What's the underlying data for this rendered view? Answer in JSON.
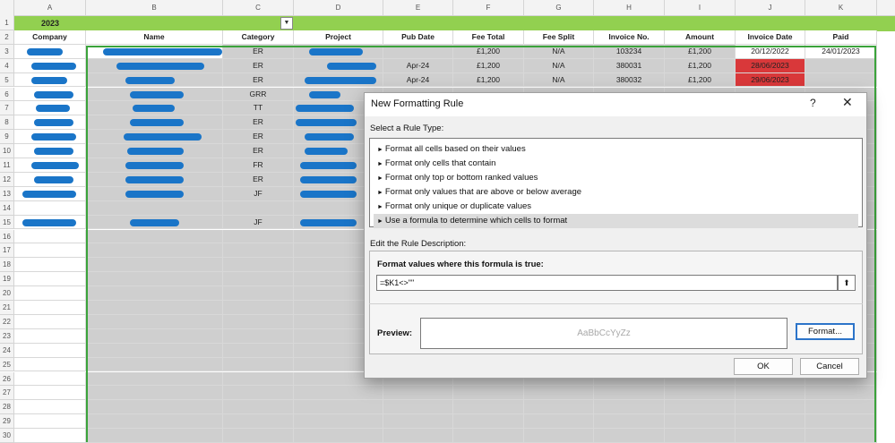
{
  "sheet": {
    "columns": [
      "A",
      "B",
      "C",
      "D",
      "E",
      "F",
      "G",
      "H",
      "I",
      "J",
      "K"
    ],
    "row_numbers": [
      "1",
      "2",
      "3",
      "4",
      "5",
      "6",
      "7",
      "8",
      "9",
      "10",
      "11",
      "12",
      "13",
      "14",
      "15",
      "16",
      "17",
      "18",
      "19",
      "20",
      "21",
      "22",
      "23",
      "24",
      "25",
      "26",
      "27",
      "28",
      "29",
      "30"
    ],
    "year_label": "2023",
    "headers": [
      "Company",
      "Name",
      "Category",
      "Project",
      "Pub Date",
      "Fee Total",
      "Fee Split",
      "Invoice No.",
      "Amount",
      "Invoice Date",
      "Paid"
    ],
    "rows": [
      [
        "",
        "",
        "ER",
        "",
        "",
        "£1,200",
        "N/A",
        "103234",
        "£1,200",
        "20/12/2022",
        "24/01/2023"
      ],
      [
        "",
        "",
        "ER",
        "",
        "Apr-24",
        "£1,200",
        "N/A",
        "380031",
        "£1,200",
        "28/06/2023",
        ""
      ],
      [
        "",
        "",
        "ER",
        "",
        "Apr-24",
        "£1,200",
        "N/A",
        "380032",
        "£1,200",
        "29/06/2023",
        ""
      ],
      [
        "",
        "",
        "GRR",
        "",
        "",
        "",
        "",
        "",
        "",
        "",
        ""
      ],
      [
        "",
        "",
        "TT",
        "",
        "",
        "",
        "",
        "",
        "",
        "",
        ""
      ],
      [
        "",
        "",
        "ER",
        "",
        "",
        "",
        "",
        "",
        "",
        "",
        ""
      ],
      [
        "",
        "",
        "ER",
        "",
        "",
        "",
        "",
        "",
        "",
        "",
        ""
      ],
      [
        "",
        "",
        "ER",
        "",
        "",
        "",
        "",
        "",
        "",
        "",
        ""
      ],
      [
        "",
        "",
        "FR",
        "",
        "",
        "",
        "",
        "",
        "",
        "",
        ""
      ],
      [
        "",
        "",
        "ER",
        "",
        "",
        "",
        "",
        "",
        "",
        "",
        ""
      ],
      [
        "",
        "",
        "JF",
        "",
        "",
        "",
        "",
        "",
        "",
        "",
        ""
      ],
      [
        "",
        "",
        "",
        "",
        "",
        "",
        "",
        "",
        "",
        "",
        ""
      ],
      [
        "",
        "",
        "JF",
        "",
        "",
        "",
        "",
        "",
        "",
        "",
        ""
      ]
    ],
    "highlight_color": "#92d050",
    "flag_color": "#d9383a"
  },
  "dialog": {
    "title": "New Formatting Rule",
    "help": "?",
    "close": "✕",
    "select_rule_type_label": "Select a Rule Type:",
    "rule_types": [
      "Format all cells based on their values",
      "Format only cells that contain",
      "Format only top or bottom ranked values",
      "Format only values that are above or below average",
      "Format only unique or duplicate values",
      "Use a formula to determine which cells to format"
    ],
    "selected_rule_index": 5,
    "edit_rule_label": "Edit the Rule Description:",
    "formula_label": "Format values where this formula is true:",
    "formula_value": "=$K1<>\"\"",
    "preview_label": "Preview:",
    "preview_sample": "AaBbCcYyZz",
    "format_button": "Format...",
    "ok_button": "OK",
    "cancel_button": "Cancel"
  }
}
